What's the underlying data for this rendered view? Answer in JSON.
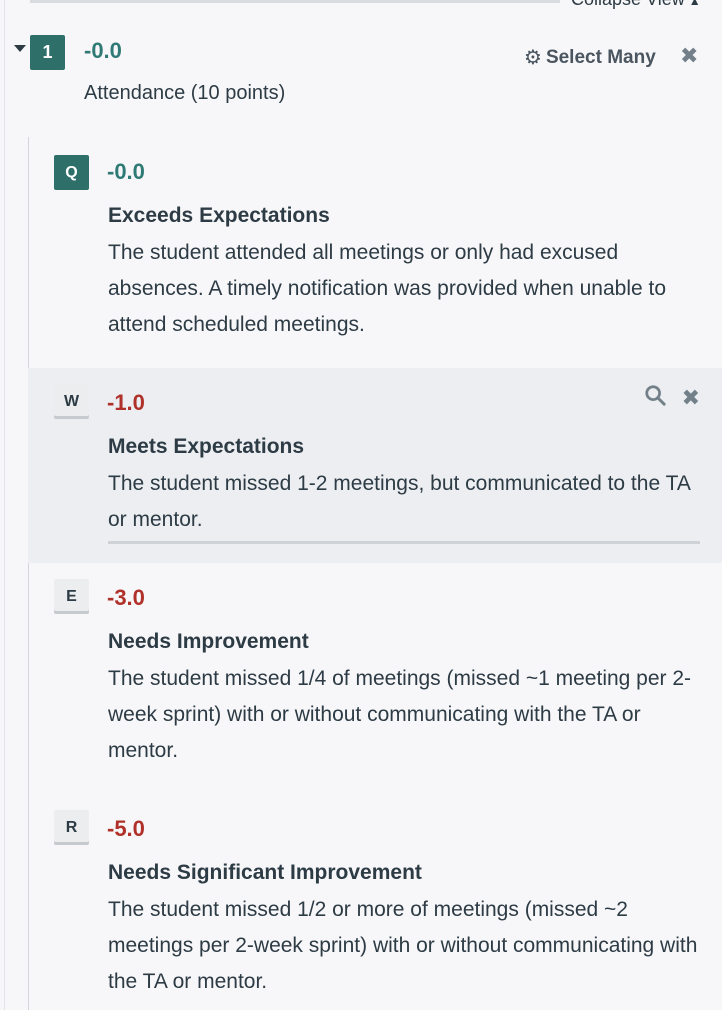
{
  "header": {
    "collapse_view_label": "Collapse View",
    "collapse_arrow": "▲"
  },
  "question": {
    "number": "1",
    "score": "-0.0",
    "title": "Attendance (10 points)",
    "select_many_label": "Select Many",
    "gear_icon": "⚙",
    "close_icon": "✖"
  },
  "options": [
    {
      "key": "Q",
      "score": "-0.0",
      "title": "Exceeds Expectations",
      "description": "The student attended all meetings or only had excused absences. A timely notification was provided when unable to attend scheduled meetings."
    },
    {
      "key": "W",
      "score": "-1.0",
      "title": "Meets Expectations",
      "description": "The student missed 1-2 meetings, but communicated to the TA or mentor."
    },
    {
      "key": "E",
      "score": "-3.0",
      "title": "Needs Improvement",
      "description": "The student missed 1/4 of meetings (missed ~1 meeting per 2-week sprint) with or without communicating with the TA or mentor."
    },
    {
      "key": "R",
      "score": "-5.0",
      "title": "Needs Significant Improvement",
      "description": "The student missed 1/2 or more of meetings (missed ~2 meetings per 2-week sprint) with or without communicating with the TA or mentor."
    }
  ],
  "icons": {
    "close": "✖"
  },
  "colors": {
    "accent": "#2f6f6a",
    "positive_score": "#2f7a74",
    "negative_score": "#b0302a"
  }
}
